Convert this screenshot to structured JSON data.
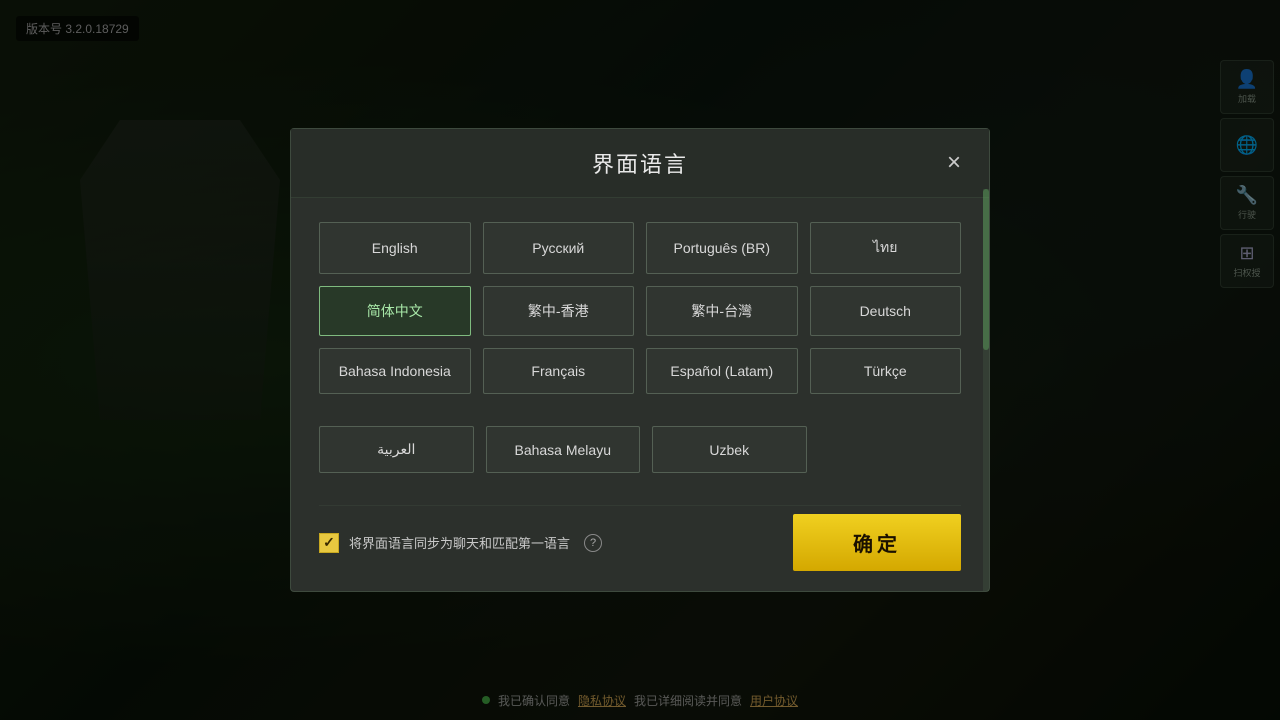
{
  "version": {
    "label": "版本号 3.2.0.18729"
  },
  "modal": {
    "title": "界面语言",
    "close_label": "×",
    "languages": [
      {
        "id": "english",
        "label": "English",
        "selected": false
      },
      {
        "id": "russian",
        "label": "Русский",
        "selected": false
      },
      {
        "id": "portuguese_br",
        "label": "Português (BR)",
        "selected": false
      },
      {
        "id": "thai",
        "label": "ไทย",
        "selected": false
      },
      {
        "id": "simplified_chinese",
        "label": "简体中文",
        "selected": true
      },
      {
        "id": "traditional_hk",
        "label": "繁中-香港",
        "selected": false
      },
      {
        "id": "traditional_tw",
        "label": "繁中-台灣",
        "selected": false
      },
      {
        "id": "deutsch",
        "label": "Deutsch",
        "selected": false
      },
      {
        "id": "bahasa_indonesia",
        "label": "Bahasa Indonesia",
        "selected": false
      },
      {
        "id": "french",
        "label": "Français",
        "selected": false
      },
      {
        "id": "spanish_latam",
        "label": "Español (Latam)",
        "selected": false
      },
      {
        "id": "turkish",
        "label": "Türkçe",
        "selected": false
      },
      {
        "id": "arabic",
        "label": "العربية",
        "selected": false
      },
      {
        "id": "bahasa_malay",
        "label": "Bahasa Melayu",
        "selected": false
      },
      {
        "id": "uzbek",
        "label": "Uzbek",
        "selected": false
      }
    ],
    "sync_checkbox": {
      "checked": true,
      "label": "将界面语言同步为聊天和匹配第一语言"
    },
    "confirm_label": "确定"
  },
  "bottom_bar": {
    "agree_text": "我已确认同意",
    "privacy_link": "隐私协议",
    "read_text": "我已详细阅读并同意",
    "terms_link": "用户协议"
  },
  "right_icons": [
    {
      "id": "avatar",
      "symbol": "👤",
      "label": "加载"
    },
    {
      "id": "globe",
      "symbol": "🌐",
      "label": ""
    },
    {
      "id": "tools",
      "symbol": "🔧",
      "label": "行驶"
    },
    {
      "id": "qr",
      "symbol": "⊞",
      "label": "扫权授"
    }
  ]
}
